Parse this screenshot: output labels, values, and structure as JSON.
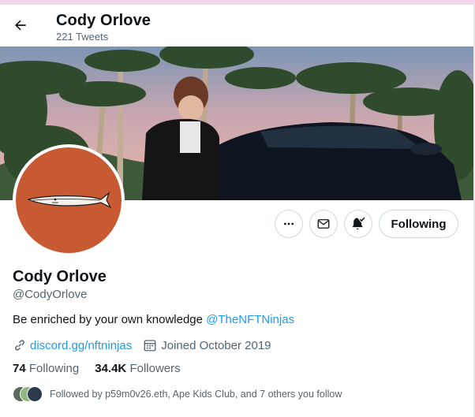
{
  "header": {
    "name": "Cody Orlove",
    "tweet_count": "221 Tweets"
  },
  "profile": {
    "display_name": "Cody Orlove",
    "handle": "@CodyOrlove",
    "bio_text": "Be enriched by your own knowledge ",
    "bio_mention": "@TheNFTNinjas",
    "website": "discord.gg/nftninjas",
    "joined": "Joined October 2019"
  },
  "actions": {
    "more_icon": "more-icon",
    "message_icon": "envelope-icon",
    "notify_icon": "bell-check-icon",
    "follow_label": "Following"
  },
  "stats": {
    "following_count": "74",
    "following_label": "Following",
    "followers_count": "34.4K",
    "followers_label": "Followers"
  },
  "followed_by": {
    "text": "Followed by p59m0v26.eth, Ape Kids Club, and 7 others you follow"
  },
  "colors": {
    "accent": "#1d9bf0",
    "avatar_bg": "#c85a33",
    "text_secondary": "#536471"
  }
}
